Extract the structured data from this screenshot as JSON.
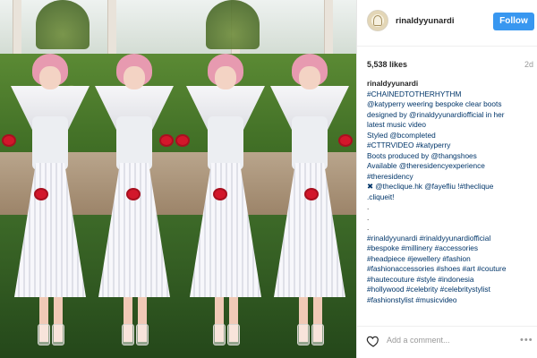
{
  "post": {
    "username": "rinaldyyunardi",
    "follow_label": "Follow",
    "likes": "5,538 likes",
    "age": "2d"
  },
  "caption": {
    "lines": [
      {
        "text": "rinaldyyunardi",
        "style": "owner"
      },
      {
        "text": "#CHAINEDTOTHERHYTHM",
        "style": "link"
      },
      {
        "text": "@katyperry weering bespoke clear boots",
        "style": "link"
      },
      {
        "text": "designed by @rinaldyyunardiofficial in her",
        "style": "link"
      },
      {
        "text": "latest music video",
        "style": "link"
      },
      {
        "text": "Styled @bcompleted",
        "style": "link"
      },
      {
        "text": "#CTTRVIDEO #katyperry",
        "style": "link"
      },
      {
        "text": "Boots produced by @thangshoes",
        "style": "link"
      },
      {
        "text": "Available @theresidencyexperience",
        "style": "link"
      },
      {
        "text": "#theresidency",
        "style": "link"
      },
      {
        "text": "✖ @theclique.hk @fayefliu !#theclique",
        "style": "link"
      },
      {
        "text": ".cliqueit!",
        "style": "link"
      },
      {
        "text": ".",
        "style": "plain"
      },
      {
        "text": ".",
        "style": "plain"
      },
      {
        "text": ".",
        "style": "plain"
      },
      {
        "text": "#rinaldyyunardi #rinaldyyunardiofficial",
        "style": "link"
      },
      {
        "text": "#bespoke #millinery #accessories",
        "style": "link"
      },
      {
        "text": "#headpiece #jewellery #fashion",
        "style": "link"
      },
      {
        "text": "#fashionaccessories #shoes #art #couture",
        "style": "link"
      },
      {
        "text": "#hautecouture #style #indonesia",
        "style": "link"
      },
      {
        "text": "#hollywood #celebrity #celebritystylist",
        "style": "link"
      },
      {
        "text": "#fashionstylist #musicvideo",
        "style": "link"
      }
    ]
  },
  "comment": {
    "placeholder": "Add a comment...",
    "more_label": "•••"
  },
  "icons": {
    "heart": "heart-icon",
    "more": "more-options-icon"
  },
  "colors": {
    "follow_button": "#3897f0",
    "link": "#003569"
  }
}
